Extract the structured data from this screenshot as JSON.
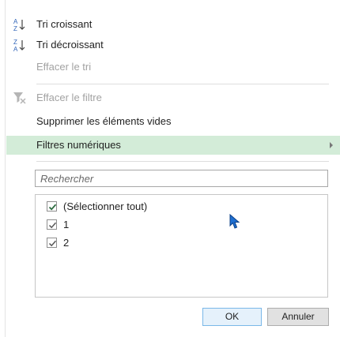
{
  "menu": {
    "sort_asc": "Tri croissant",
    "sort_desc": "Tri décroissant",
    "clear_sort": "Effacer le tri",
    "clear_filter": "Effacer le filtre",
    "remove_empty": "Supprimer les éléments vides",
    "numeric_filters": "Filtres numériques"
  },
  "search": {
    "placeholder": "Rechercher"
  },
  "list": {
    "items": [
      {
        "label": "(Sélectionner tout)",
        "checked": true
      },
      {
        "label": "1",
        "checked": true
      },
      {
        "label": "2",
        "checked": true
      }
    ]
  },
  "buttons": {
    "ok": "OK",
    "cancel": "Annuler"
  },
  "colors": {
    "highlight": "#d3ecd8",
    "sort_icon_blue": "#2f63b8",
    "checkmark": "#2b6b3f",
    "disabled_text": "#a2a2a2",
    "cursor": "#1f6fd1"
  },
  "icons": {
    "sort_asc": "sort-az-icon",
    "sort_desc": "sort-za-icon",
    "clear_filter": "funnel-clear-icon",
    "submenu": "chevron-right-icon",
    "cursor": "mouse-pointer-icon"
  }
}
